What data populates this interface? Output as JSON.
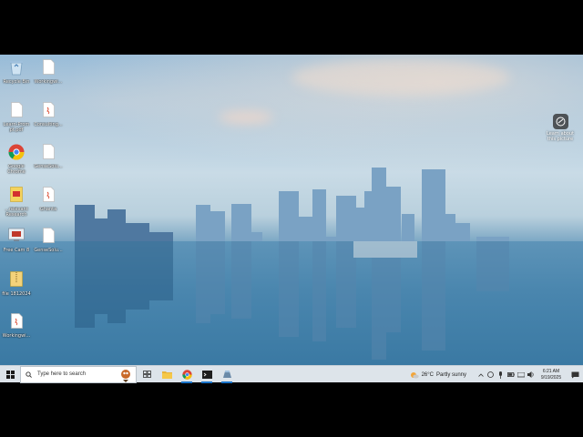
{
  "desktop_icons": [
    {
      "name": "recycle-bin",
      "label": "Recycle Bin",
      "kind": "recycle"
    },
    {
      "name": "file-1",
      "label": "Workingwi...",
      "kind": "doc"
    },
    {
      "name": "file-2",
      "label": "Learn-Prom\npt.pdf",
      "kind": "doc"
    },
    {
      "name": "file-3",
      "label": "Consulting...",
      "kind": "java"
    },
    {
      "name": "google-chrome",
      "label": "Google\nChrome",
      "kind": "chrome"
    },
    {
      "name": "file-4",
      "label": "GenseSolu...",
      "kind": "doc"
    },
    {
      "name": "file-5",
      "label": "...relevant\nResearch",
      "kind": "red"
    },
    {
      "name": "file-6",
      "label": "Ghanta",
      "kind": "java"
    },
    {
      "name": "file-7",
      "label": "Free Cam 8",
      "kind": "cam"
    },
    {
      "name": "file-8",
      "label": "GenseSolu...",
      "kind": "doc"
    },
    {
      "name": "file-9",
      "label": "file 1812024",
      "kind": "zip"
    },
    {
      "name": "file-10",
      "label": "Workingwi...",
      "kind": "java"
    }
  ],
  "learn_about": {
    "label": "Learn about\nthis picture"
  },
  "taskbar": {
    "search_placeholder": "Type here to search",
    "weather_temp": "26°C",
    "weather_text": "Partly sunny",
    "time": "6:21 AM",
    "date": "9/19/2025"
  },
  "colors": {
    "taskbar_bg": "#dde4ea",
    "accent": "#1a73c9"
  }
}
